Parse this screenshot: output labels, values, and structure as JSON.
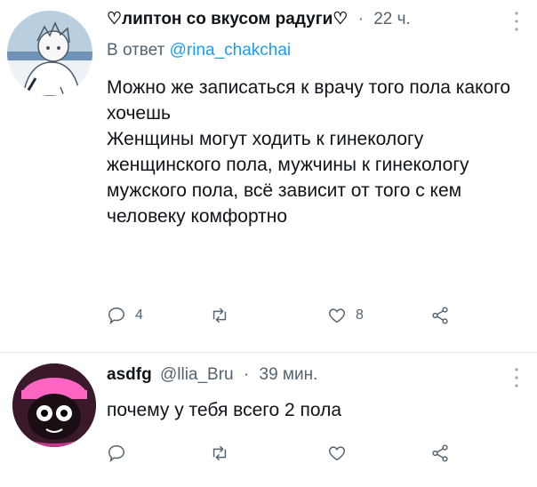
{
  "tweet1": {
    "display_name": "♡липтон со вкусом радуги♡",
    "separator": "·",
    "time": "22 ч.",
    "reply_prefix": "В ответ",
    "reply_handle": "@rina_chakchai",
    "body_lines": [
      "Можно же записаться к врачу того пола какого хочешь",
      "Женщины могут ходить к гинекологу женщинского пола, мужчины к гинекологу мужского пола, всё зависит от того с кем человеку комфортно"
    ],
    "reply_count": "4",
    "retweet_count": "",
    "like_count": "8"
  },
  "tweet2": {
    "display_name": "asdfg",
    "handle": "@llia_Bru",
    "separator": "·",
    "time": "39 мин.",
    "body": "почему у тебя всего 2 пола"
  },
  "icons": {
    "reply": "reply-icon",
    "retweet": "retweet-icon",
    "like": "heart-icon",
    "share": "share-icon",
    "more": "more-vertical-icon"
  },
  "colors": {
    "link": "#1d9bf0",
    "secondary_text": "#536471",
    "primary_text": "#0f1419"
  }
}
